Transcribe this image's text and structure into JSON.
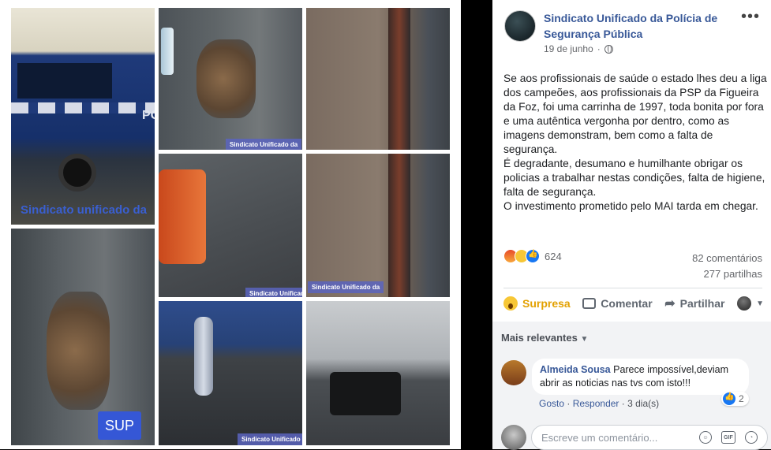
{
  "media": {
    "watermark": "Sindicato Unificado da",
    "watermark_van": "Sindicato unificado da",
    "van_lettering": "PO",
    "sup_label": "SUP"
  },
  "post": {
    "page_name": "Sindicato Unificado da Polícia de Segurança Pública",
    "date": "19 de junho",
    "paragraphs": [
      "Se aos profissionais de saúde o estado lhes deu a liga dos campeões, aos profissionais da PSP da Figueira da Foz, foi uma carrinha de 1997, toda bonita por fora e uma autêntica vergonha por dentro, como as imagens demonstram, bem como a falta de segurança.",
      "É degradante, desumano e humilhante obrigar os policias a trabalhar nestas condições, falta de higiene, falta de segurança.",
      "O investimento prometido pelo MAI tarda em chegar."
    ],
    "reaction_count": "624",
    "comments_count": "82 comentários",
    "shares_count": "277 partilhas",
    "colors": {
      "link": "#385898",
      "surpresa": "#e3a102"
    }
  },
  "actions": {
    "react_label": "Surpresa",
    "comment_label": "Comentar",
    "share_label": "Partilhar"
  },
  "comments": {
    "sort_label": "Mais relevantes",
    "items": [
      {
        "author": "Almeida Sousa",
        "text": "Parece impossível,deviam abrir as noticias nas tvs com isto!!!",
        "likes": "2",
        "like_label": "Gosto",
        "reply_label": "Responder",
        "time": "3 dia(s)"
      }
    ],
    "compose_placeholder": "Escreve um comentário..."
  }
}
